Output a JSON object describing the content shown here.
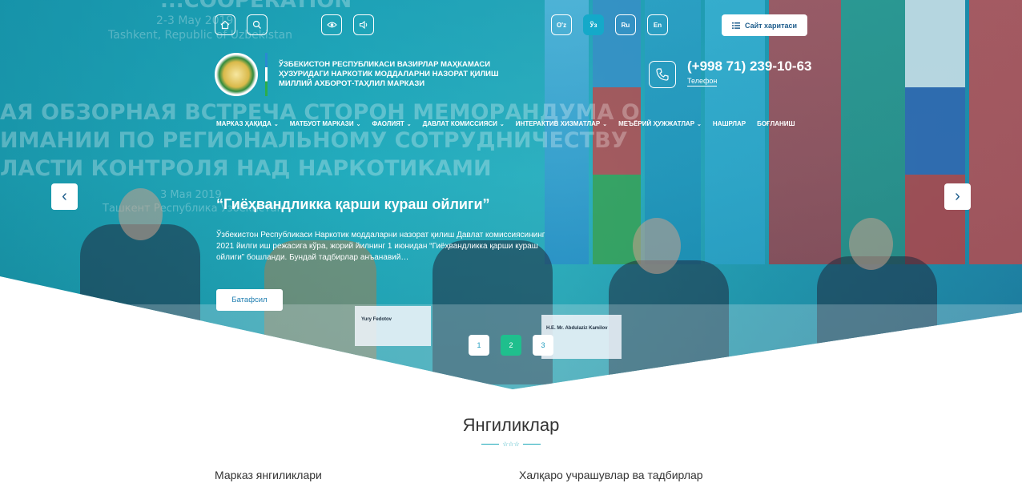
{
  "banner": {
    "en_line1": "2-3 May 2019",
    "en_line2": "Tashkent, Republic of Uzbekistan",
    "ru_line1": "АЯ ОБЗОРНАЯ ВСТРЕЧА СТОРОН МЕМОРАНДУМА О",
    "ru_line2": "ИМАНИИ ПО РЕГИОНАЛЬНОМУ СОТРУДНИЧЕСТВУ",
    "ru_line3": "ЛАСТИ КОНТРОЛЯ НАД НАРКОТИКАМИ",
    "ru_date": "3 Мая 2019",
    "ru_place": "Ташкент Республика Узбекистан",
    "top_partial": "...COOPERATION",
    "nameplate1_name": "Yury Fedotov",
    "nameplate2_name": "H.E. Mr. Abdulaziz Kamilov"
  },
  "topbar": {
    "icons": [
      "home-icon",
      "search-icon",
      "eye-icon",
      "speaker-icon"
    ],
    "languages": [
      {
        "label": "O'z",
        "active": false
      },
      {
        "label": "Ўз",
        "active": true
      },
      {
        "label": "Ru",
        "active": false
      },
      {
        "label": "En",
        "active": false
      }
    ],
    "sitemap_label": "Сайт харитаси"
  },
  "header": {
    "org_line1": "ЎЗБЕКИСТОН РЕСПУБЛИКАСИ ВАЗИРЛАР МАҲКАМАСИ",
    "org_line2": "ҲУЗУРИДАГИ НАРКОТИК МОДДАЛАРНИ НАЗОРАТ ҚИЛИШ",
    "org_line3": "МИЛЛИЙ АХБОРОТ-ТАҲЛИЛ МАРКАЗИ",
    "phone": "(+998 71) 239-10-63",
    "phone_label": "Телефон"
  },
  "nav": [
    {
      "label": "МАРКАЗ ҲАҚИДА",
      "dropdown": true
    },
    {
      "label": "МАТБУОТ МАРКАЗИ",
      "dropdown": true
    },
    {
      "label": "ФАОЛИЯТ",
      "dropdown": true
    },
    {
      "label": "ДАВЛАТ КОМИССИЯСИ",
      "dropdown": true
    },
    {
      "label": "ИНТЕРАКТИВ ХИЗМАТЛАР",
      "dropdown": true
    },
    {
      "label": "МЕЪЁРИЙ ҲУЖЖАТЛАР",
      "dropdown": true
    },
    {
      "label": "НАШРЛАР",
      "dropdown": false
    },
    {
      "label": "БОҒЛАНИШ",
      "dropdown": false
    }
  ],
  "slider": {
    "title": "“Гиёҳвандликка қарши кураш ойлиги”",
    "text": "Ўзбекистон Республикаси Наркотик моддаларни назорат қилиш Давлат комиссиясининг 2021 йилги иш режасига кўра, жорий йилнинг 1 июнидан “Гиёҳвандликка қарши кураш ойлиги” бошланди. Бундай тадбирлар анъанавий…",
    "more_label": "Батафсил",
    "prev": "‹",
    "next": "›",
    "pages": [
      "1",
      "2",
      "3"
    ],
    "active_page": 2
  },
  "news": {
    "title": "Янгиликлар",
    "ornament": "☆☆☆",
    "col1": "Марказ янгиликлари",
    "col2": "Халқаро учрашувлар ва тадбирлар"
  },
  "colors": {
    "accent": "#14a9c9",
    "active_dot": "#1fbf8d",
    "nav_text": "#ffffff"
  }
}
